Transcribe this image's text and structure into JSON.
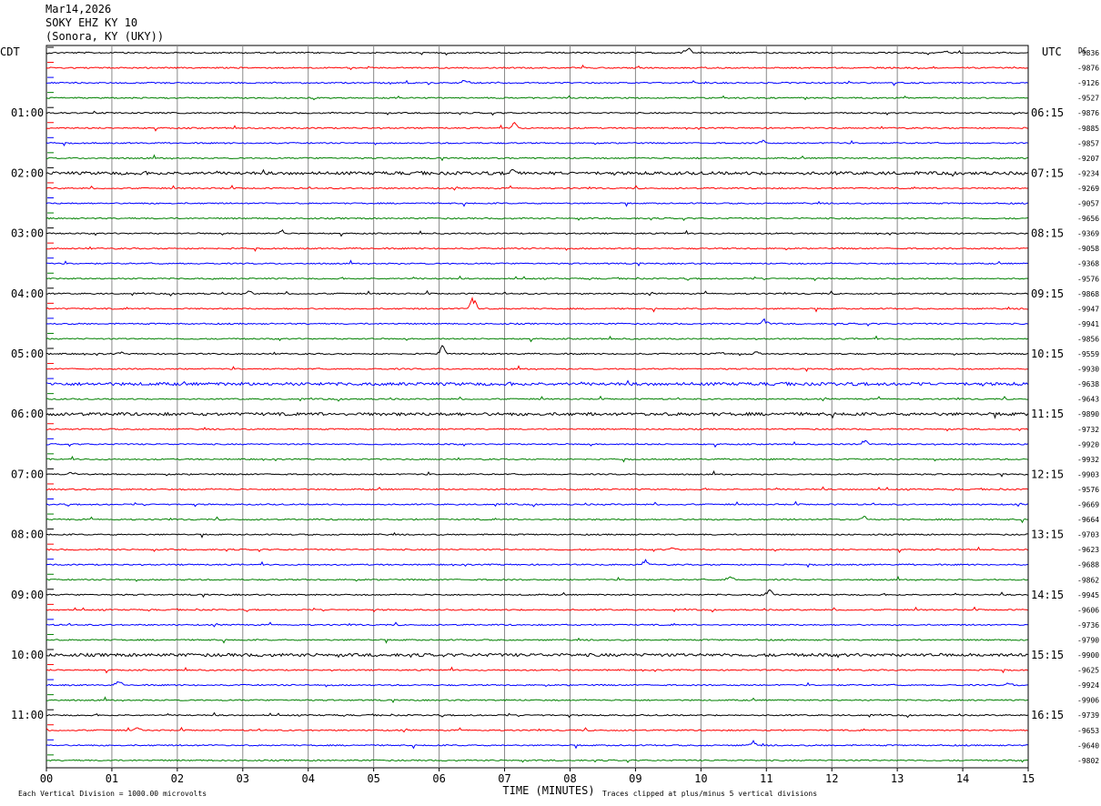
{
  "header": {
    "date": "Mar14,2026",
    "station": "SOKY EHZ KY 10",
    "location": "(Sonora, KY (UKY))"
  },
  "chart_data": {
    "type": "line",
    "subtype": "helicorder",
    "left_timezone_label": "CDT",
    "right_timezone_label": "UTC",
    "right_top_label": "DC",
    "x_ticks": [
      "00",
      "01",
      "02",
      "03",
      "04",
      "05",
      "06",
      "07",
      "08",
      "09",
      "10",
      "11",
      "12",
      "13",
      "14",
      "15"
    ],
    "xlabel": "TIME (MINUTES)",
    "xlim": [
      0,
      15
    ],
    "left_hour_labels": [
      "01:00",
      "02:00",
      "03:00",
      "04:00",
      "05:00",
      "06:00",
      "07:00",
      "08:00",
      "09:00",
      "10:00",
      "11:00"
    ],
    "right_hour_labels": [
      "06:15",
      "07:15",
      "08:15",
      "09:15",
      "10:15",
      "11:15",
      "12:15",
      "13:15",
      "14:15",
      "15:15",
      "16:15"
    ],
    "trace_colors": [
      "#000000",
      "#ff0000",
      "#0000ff",
      "#008000"
    ],
    "grid": true,
    "grid_color": "#888888",
    "trace_count": 48,
    "dc_offsets": [
      "-9836",
      "-9876",
      "-9126",
      "-9527",
      "-9876",
      "-9885",
      "-9857",
      "-9207",
      "-9234",
      "-9269",
      "-9057",
      "-9656",
      "-9369",
      "-9058",
      "-9368",
      "-9576",
      "-9868",
      "-9947",
      "-9941",
      "-9856",
      "-9559",
      "-9930",
      "-9638",
      "-9643",
      "-9890",
      "-9732",
      "-9920",
      "-9932",
      "-9903",
      "-9576",
      "-9669",
      "-9664",
      "-9703",
      "-9623",
      "-9688",
      "-9862",
      "-9945",
      "-9606",
      "-9736",
      "-9790",
      "-9900",
      "-9625",
      "-9924",
      "-9906",
      "-9739",
      "-9653",
      "-9640",
      "-9802"
    ],
    "notable_events": [
      {
        "trace": 0,
        "minute": 9.8,
        "amplitude": 7,
        "sign": -1
      },
      {
        "trace": 0,
        "minute": 13.75,
        "amplitude": 3,
        "sign": -1
      },
      {
        "trace": 2,
        "minute": 6.4,
        "amplitude": 4,
        "sign": -1
      },
      {
        "trace": 5,
        "minute": 7.15,
        "amplitude": 6,
        "sign": -1
      },
      {
        "trace": 6,
        "minute": 10.95,
        "amplitude": 3,
        "sign": -1
      },
      {
        "trace": 8,
        "minute": 7.15,
        "amplitude": 6,
        "sign": -1
      },
      {
        "trace": 12,
        "minute": 3.6,
        "amplitude": 4,
        "sign": -1
      },
      {
        "trace": 16,
        "minute": 3.1,
        "amplitude": 3,
        "sign": -1
      },
      {
        "trace": 17,
        "minute": 6.52,
        "amplitude": 14,
        "sign": -1
      },
      {
        "trace": 18,
        "minute": 10.98,
        "amplitude": 6,
        "sign": -1
      },
      {
        "trace": 20,
        "minute": 1.15,
        "amplitude": 3,
        "sign": -1
      },
      {
        "trace": 20,
        "minute": 6.05,
        "amplitude": 9,
        "sign": -1
      },
      {
        "trace": 20,
        "minute": 10.3,
        "amplitude": 2,
        "sign": -1
      },
      {
        "trace": 20,
        "minute": 10.85,
        "amplitude": 2,
        "sign": -1
      },
      {
        "trace": 26,
        "minute": 12.5,
        "amplitude": 5,
        "sign": -1
      },
      {
        "trace": 28,
        "minute": 0.4,
        "amplitude": 3,
        "sign": -1
      },
      {
        "trace": 31,
        "minute": 12.5,
        "amplitude": 4,
        "sign": -1
      },
      {
        "trace": 33,
        "minute": 9.58,
        "amplitude": 4,
        "sign": -1
      },
      {
        "trace": 34,
        "minute": 9.15,
        "amplitude": 4,
        "sign": -1
      },
      {
        "trace": 35,
        "minute": 10.45,
        "amplitude": 6,
        "sign": -1
      },
      {
        "trace": 36,
        "minute": 11.05,
        "amplitude": 5,
        "sign": -1
      },
      {
        "trace": 42,
        "minute": 1.1,
        "amplitude": 5,
        "sign": -1
      },
      {
        "trace": 42,
        "minute": 14.7,
        "amplitude": 3,
        "sign": -1
      },
      {
        "trace": 45,
        "minute": 1.4,
        "amplitude": 3,
        "sign": -1
      },
      {
        "trace": 46,
        "minute": 10.8,
        "amplitude": 5,
        "sign": -1
      }
    ],
    "noisy_traces": [
      8,
      22,
      24,
      40
    ],
    "footer_left": "Each Vertical Division = 1000.00 microvolts",
    "footer_right": "Traces clipped at plus/minus 5 vertical divisions"
  }
}
